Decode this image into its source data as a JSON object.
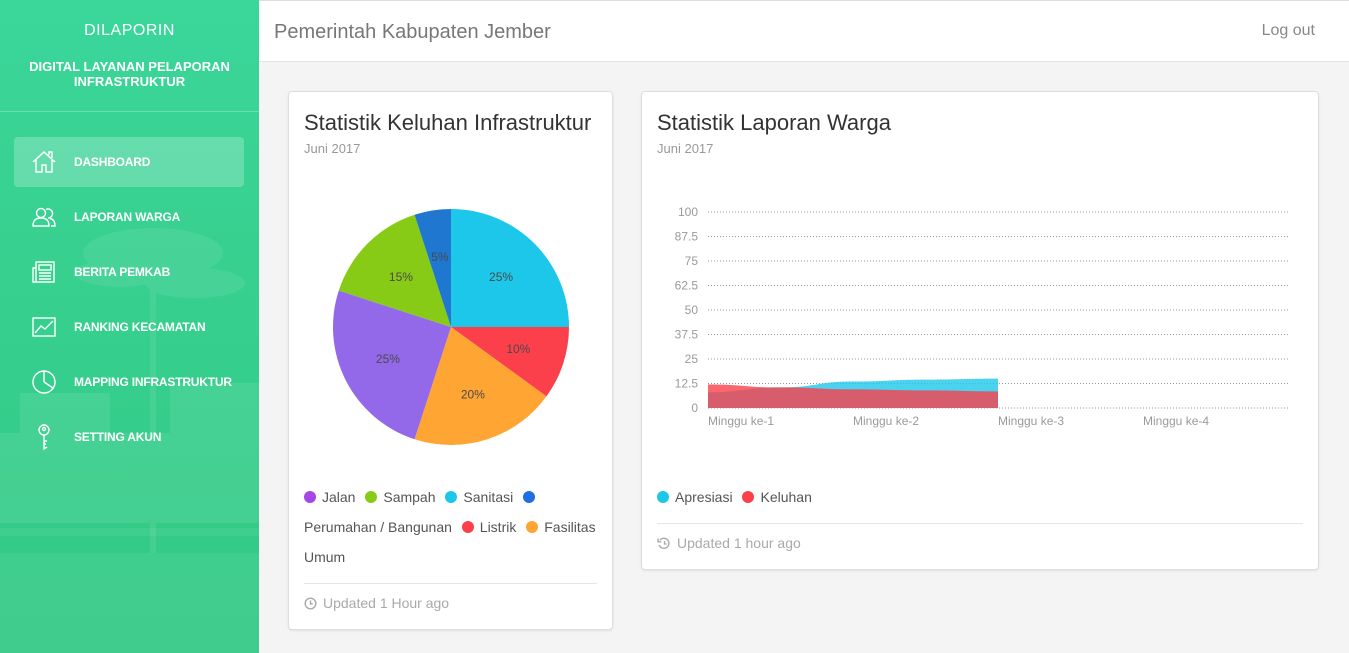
{
  "sidebar": {
    "brand": "DILAPORIN",
    "subtitle": "DIGITAL LAYANAN PELAPORAN INFRASTRUKTUR",
    "items": [
      {
        "label": "DASHBOARD",
        "icon": "home-icon",
        "active": true
      },
      {
        "label": "LAPORAN WARGA",
        "icon": "users-icon",
        "active": false
      },
      {
        "label": "BERITA PEMKAB",
        "icon": "newspaper-icon",
        "active": false
      },
      {
        "label": "RANKING KECAMATAN",
        "icon": "line-chart-icon",
        "active": false
      },
      {
        "label": "MAPPING INFRASTRUKTUR",
        "icon": "pie-chart-icon",
        "active": false
      },
      {
        "label": "SETTING AKUN",
        "icon": "key-icon",
        "active": false
      }
    ]
  },
  "header": {
    "title": "Pemerintah Kabupaten Jember",
    "logout_label": "Log out"
  },
  "pie_card": {
    "title": "Statistik Keluhan Infrastruktur",
    "subtitle": "Juni 2017",
    "footer": "Updated 1 Hour ago",
    "legend": [
      {
        "label": "Jalan",
        "color": "#a347e6"
      },
      {
        "label": "Sampah",
        "color": "#87cb16"
      },
      {
        "label": "Sanitasi",
        "color": "#1dc7ea"
      },
      {
        "label": "Perumahan / Bangunan",
        "color": "#1f6fe0"
      },
      {
        "label": "Listrik",
        "color": "#fb404b"
      },
      {
        "label": "Fasilitas Umum",
        "color": "#ffa534"
      }
    ]
  },
  "line_card": {
    "title": "Statistik Laporan Warga",
    "subtitle": "Juni 2017",
    "footer": "Updated 1 hour ago",
    "legend": [
      {
        "label": "Apresiasi",
        "color": "#1dc7ea"
      },
      {
        "label": "Keluhan",
        "color": "#fb404b"
      }
    ]
  },
  "chart_data": [
    {
      "type": "pie",
      "title": "Statistik Keluhan Infrastruktur",
      "slices": [
        {
          "label": "Sanitasi",
          "value": 25,
          "display": "25%",
          "color": "#1dc7ea"
        },
        {
          "label": "Listrik",
          "value": 10,
          "display": "10%",
          "color": "#fb404b"
        },
        {
          "label": "Fasilitas Umum",
          "value": 20,
          "display": "20%",
          "color": "#ffa534"
        },
        {
          "label": "Jalan",
          "value": 25,
          "display": "25%",
          "color": "#9368e9"
        },
        {
          "label": "Sampah",
          "value": 15,
          "display": "15%",
          "color": "#87cb16"
        },
        {
          "label": "Perumahan / Bangunan",
          "value": 5,
          "display": "5%",
          "color": "#1f77d0"
        }
      ]
    },
    {
      "type": "area",
      "title": "Statistik Laporan Warga",
      "categories": [
        "Minggu ke-1",
        "Minggu ke-2",
        "Minggu ke-3",
        "Minggu ke-4"
      ],
      "yticks": [
        "100",
        "87.5",
        "75",
        "62.5",
        "50",
        "37.5",
        "25",
        "12.5",
        "0"
      ],
      "ylim": [
        0,
        100
      ],
      "grid": true,
      "legend_position": "bottom",
      "series": [
        {
          "name": "Apresiasi",
          "color": "#1dc7ea",
          "x": [
            0,
            0.5,
            1,
            1.5,
            2
          ],
          "y": [
            8,
            10.5,
            13.5,
            14.5,
            15
          ]
        },
        {
          "name": "Keluhan",
          "color": "#fb404b",
          "x": [
            0,
            0.5,
            1,
            1.5,
            2
          ],
          "y": [
            12,
            10.5,
            9.5,
            9,
            8.5
          ]
        }
      ]
    }
  ]
}
